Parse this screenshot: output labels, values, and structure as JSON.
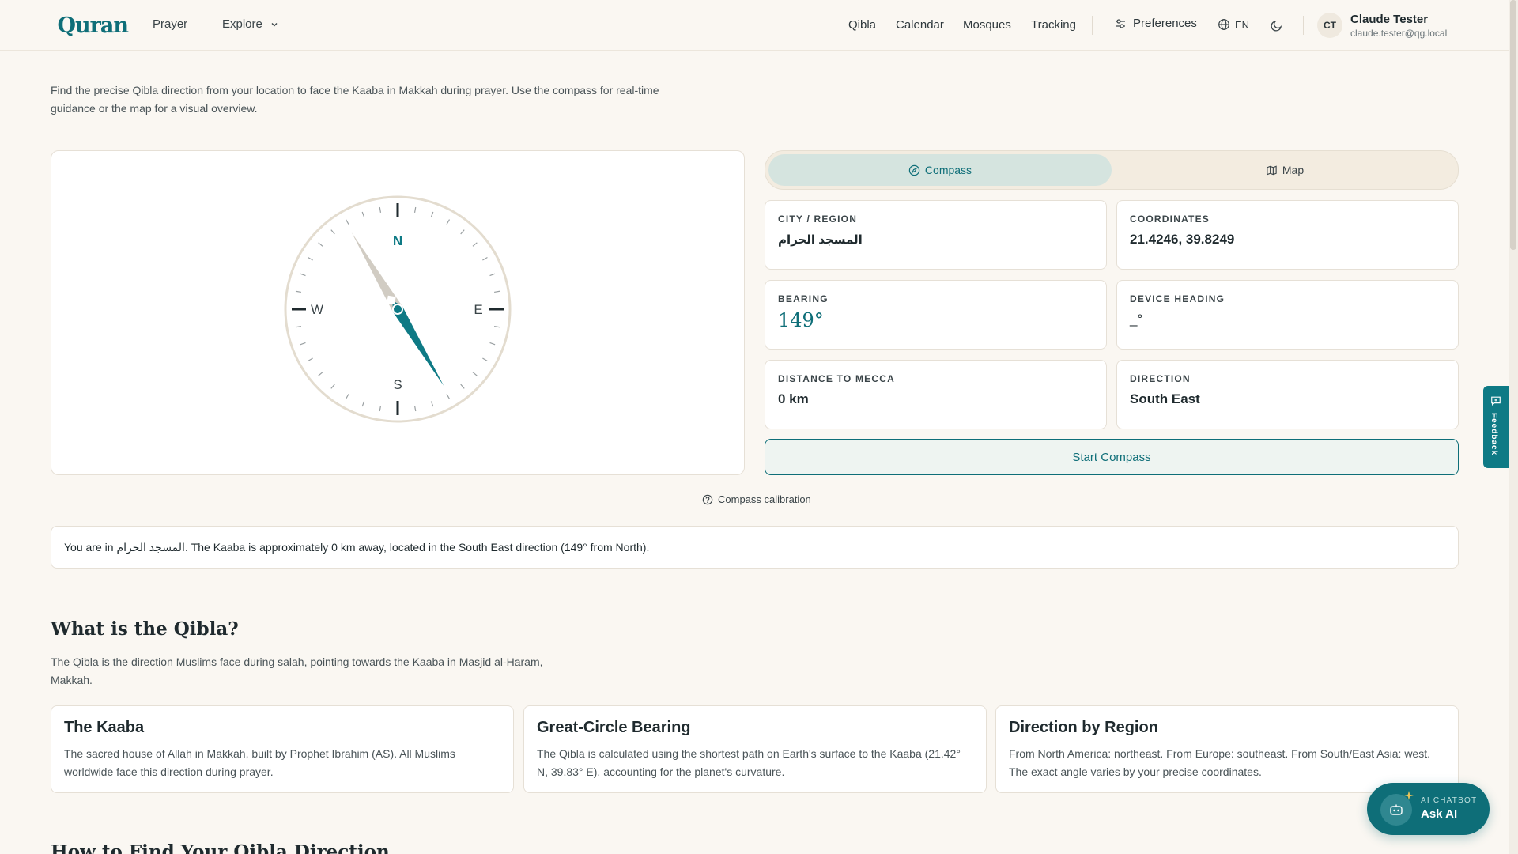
{
  "header": {
    "logo_text": "Quran",
    "nav_left": [
      {
        "label": "Prayer"
      },
      {
        "label": "Explore"
      }
    ],
    "nav_right": [
      {
        "label": "Qibla"
      },
      {
        "label": "Calendar"
      },
      {
        "label": "Mosques"
      },
      {
        "label": "Tracking"
      }
    ],
    "preferences_label": "Preferences",
    "language_label": "EN",
    "user": {
      "initials": "CT",
      "name": "Claude Tester",
      "email": "claude.tester@qg.local"
    }
  },
  "intro": "Find the precise Qibla direction from your location to face the Kaaba in Makkah during prayer. Use the compass for real-time guidance or the map for a visual overview.",
  "compass": {
    "cardinals": {
      "n": "N",
      "e": "E",
      "s": "S",
      "w": "W"
    },
    "bearing_deg": 149,
    "accent_color": "#0e7a85"
  },
  "tabs": [
    {
      "label": "Compass",
      "active": true
    },
    {
      "label": "Map",
      "active": false
    }
  ],
  "info": {
    "city": {
      "label": "City / Region",
      "value": "المسجد الحرام"
    },
    "coordinates": {
      "label": "Coordinates",
      "value": "21.4246, 39.8249"
    },
    "bearing": {
      "label": "Bearing",
      "value": "149°"
    },
    "heading": {
      "label": "Device Heading",
      "value": "_°"
    },
    "distance": {
      "label": "Distance to Mecca",
      "value": "0 km"
    },
    "direction": {
      "label": "Direction",
      "value": "South East"
    }
  },
  "start_button": "Start Compass",
  "calibration_label": "Compass calibration",
  "summary": "You are in المسجد الحرام. The Kaaba is approximately 0 km away, located in the South East direction (149° from North).",
  "what_is": {
    "title": "What is the Qibla?",
    "text": "The Qibla is the direction Muslims face during salah, pointing towards the Kaaba in Masjid al-Haram, Makkah.",
    "cards": [
      {
        "title": "The Kaaba",
        "text": "The sacred house of Allah in Makkah, built by Prophet Ibrahim (AS). All Muslims worldwide face this direction during prayer."
      },
      {
        "title": "Great-Circle Bearing",
        "text": "The Qibla is calculated using the shortest path on Earth's surface to the Kaaba (21.42° N, 39.83° E), accounting for the planet's curvature."
      },
      {
        "title": "Direction by Region",
        "text": "From North America: northeast. From Europe: southeast. From South/East Asia: west. The exact angle varies by your precise coordinates."
      }
    ]
  },
  "how_to_title": "How to Find Your Qibla Direction",
  "feedback_label": "Feedback",
  "ask_ai": {
    "kicker": "AI CHATBOT",
    "label": "Ask AI"
  }
}
